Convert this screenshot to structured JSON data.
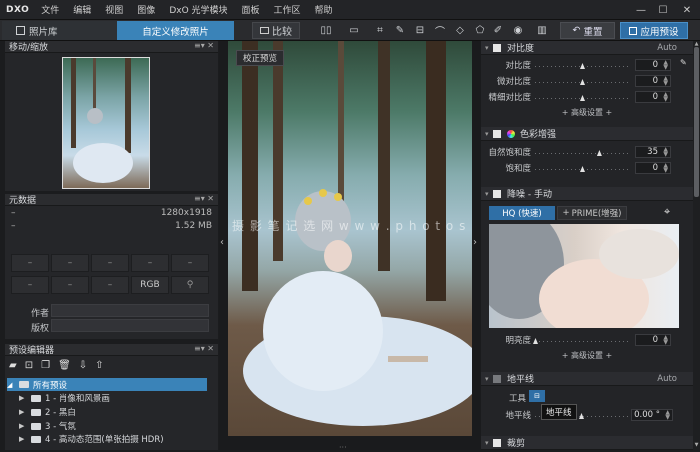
{
  "app": {
    "logo": "DXO",
    "menus": [
      "文件",
      "编辑",
      "视图",
      "图像",
      "DxO 光学模块",
      "面板",
      "工作区",
      "帮助"
    ]
  },
  "toolbar": {
    "tab_library": "照片库",
    "tab_customize": "自定义修改照片",
    "compare": "比较",
    "reset": "重置",
    "apply_preset": "应用预设"
  },
  "viewer": {
    "correction_preview": "校正预览",
    "watermark": "摄 影 笔 记 选 网   w w w . p h o t o s k s . v i p",
    "tooltip_horizon": "地平线"
  },
  "navigator": {
    "title": "移动/缩放"
  },
  "metadata": {
    "title": "元数据",
    "dimensions": "1280x1918",
    "filesize": "1.52 MB",
    "dash": "–",
    "rgb": "RGB",
    "author_label": "作者",
    "copyright_label": "版权"
  },
  "preset_editor": {
    "title": "预设编辑器",
    "items": [
      "所有预设",
      "1 - 肖像和风景画",
      "2 - 黑白",
      "3 - 气氛",
      "4 - 高动态范围(单张拍摄 HDR)"
    ]
  },
  "right_panel": {
    "contrast": {
      "title": "对比度",
      "auto": "Auto",
      "sliders": [
        {
          "label": "对比度",
          "value": "0",
          "pos": 0.5
        },
        {
          "label": "微对比度",
          "value": "0",
          "pos": 0.5
        },
        {
          "label": "精细对比度",
          "value": "0",
          "pos": 0.5
        }
      ],
      "advanced": "+ 高级设置 +"
    },
    "color": {
      "title": "色彩增强",
      "sliders": [
        {
          "label": "自然饱和度",
          "value": "35",
          "pos": 0.68
        },
        {
          "label": "饱和度",
          "value": "0",
          "pos": 0.5
        }
      ]
    },
    "noise": {
      "title": "降噪 - 手动",
      "hq": "HQ (快速)",
      "prime": "PRIME(增强)",
      "sliders": [
        {
          "label": "明亮度",
          "value": "0",
          "pos": 0.0
        }
      ],
      "advanced": "+ 高级设置 +"
    },
    "horizon": {
      "title": "地平线",
      "auto": "Auto",
      "tool_label": "工具",
      "slider_label": "地平线",
      "value": "0.00 °"
    },
    "next_section": "裁剪"
  }
}
